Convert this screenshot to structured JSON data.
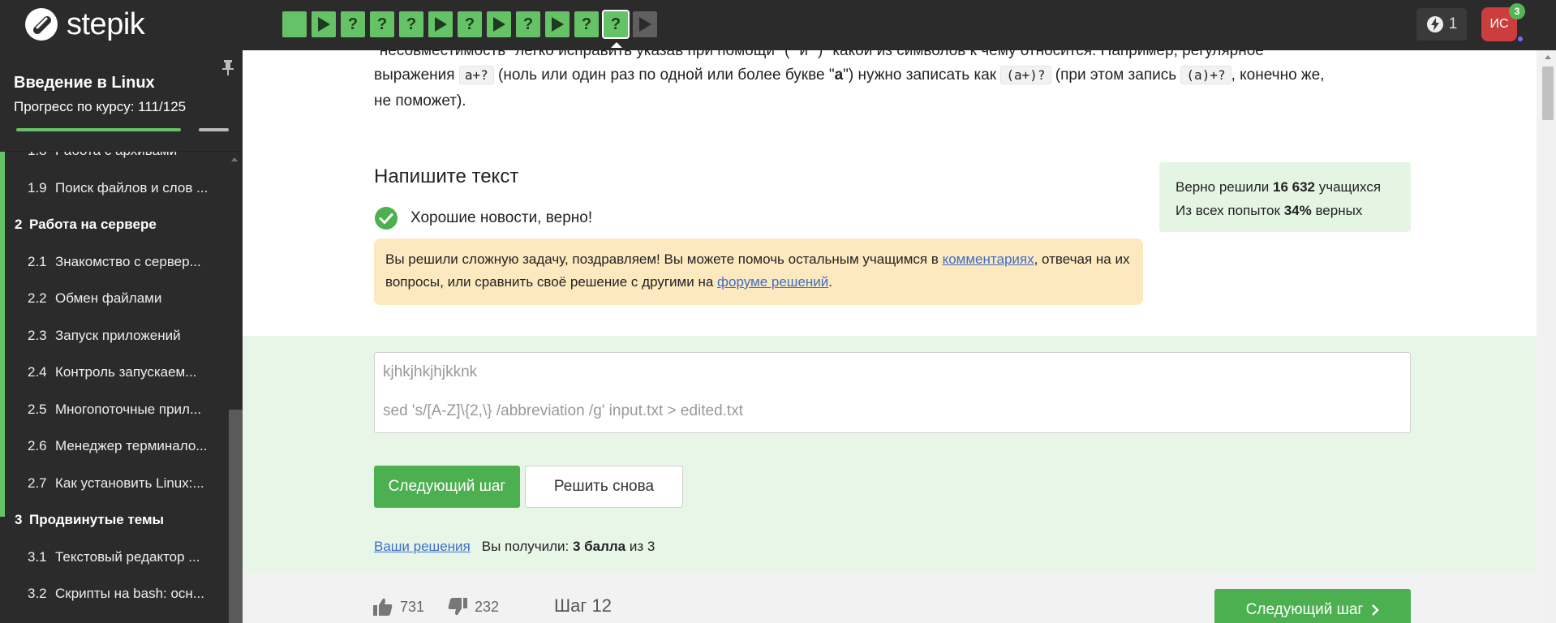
{
  "header": {
    "logo_text": "stepik",
    "steps": [
      {
        "kind": "blank",
        "color": "green"
      },
      {
        "kind": "video",
        "color": "green"
      },
      {
        "kind": "question",
        "color": "green"
      },
      {
        "kind": "question",
        "color": "green"
      },
      {
        "kind": "question",
        "color": "green"
      },
      {
        "kind": "video",
        "color": "green"
      },
      {
        "kind": "question",
        "color": "green"
      },
      {
        "kind": "video",
        "color": "green"
      },
      {
        "kind": "question",
        "color": "green"
      },
      {
        "kind": "video",
        "color": "green"
      },
      {
        "kind": "question",
        "color": "green"
      },
      {
        "kind": "question",
        "color": "green",
        "current": true
      },
      {
        "kind": "video",
        "color": "grey"
      }
    ],
    "energy_count": "1",
    "avatar_initials": "ИС",
    "notification_count": "3"
  },
  "sidebar": {
    "course_title": "Введение в Linux",
    "progress_label": "Прогресс по курсу:  111/125",
    "progress_value": 0.888,
    "items": [
      {
        "type": "item",
        "num": "1.8",
        "label": "Работа с архивами",
        "partial": true
      },
      {
        "type": "item",
        "num": "1.9",
        "label": "Поиск файлов и слов ..."
      },
      {
        "type": "section",
        "num": "2",
        "label": "Работа на сервере"
      },
      {
        "type": "item",
        "num": "2.1",
        "label": "Знакомство с сервер..."
      },
      {
        "type": "item",
        "num": "2.2",
        "label": "Обмен файлами"
      },
      {
        "type": "item",
        "num": "2.3",
        "label": "Запуск приложений"
      },
      {
        "type": "item",
        "num": "2.4",
        "label": "Контроль запускаем..."
      },
      {
        "type": "item",
        "num": "2.5",
        "label": "Многопоточные прил..."
      },
      {
        "type": "item",
        "num": "2.6",
        "label": "Менеджер терминало..."
      },
      {
        "type": "item",
        "num": "2.7",
        "label": "Как установить Linux:..."
      },
      {
        "type": "section",
        "num": "3",
        "label": "Продвинутые темы"
      },
      {
        "type": "item",
        "num": "3.1",
        "label": "Текстовый редактор ..."
      },
      {
        "type": "item",
        "num": "3.2",
        "label": "Скрипты на bash: осн..."
      }
    ]
  },
  "lesson": {
    "para_top": "\"несовместимость\" легко исправить указав при помощи \"(\" и \")\" какой из символов к чему относится. Например, регулярное",
    "para_l2_a": "выражения ",
    "code_1": "a+?",
    "para_l2_b": " (ноль или один раз по одной или более букве \"",
    "para_l2_bold": "a",
    "para_l2_c": "\") нужно записать как ",
    "code_2": "(a+)?",
    "para_l2_d": " (при этом запись ",
    "code_3": "(a)+?",
    "para_l2_e": ", конечно же,",
    "para_l3": "не поможет).",
    "section_title": "Напишите текст",
    "correct_text": "Хорошие новости, верно!",
    "congrats_a": "Вы решили сложную задачу, поздравляем! Вы можете помочь остальным учащимся в ",
    "congrats_link1": "комментариях",
    "congrats_b": ", отвечая на их вопросы, или сравнить своё решение с другими на ",
    "congrats_link2": "форуме решений",
    "congrats_c": ".",
    "stats_l1_a": "Верно решили ",
    "stats_l1_bold": "16 632",
    "stats_l1_b": " учащихся",
    "stats_l2_a": "Из всех попыток ",
    "stats_l2_bold": "34%",
    "stats_l2_b": " верных",
    "answer_line1": "kjhkjhkjhjkknk",
    "answer_line2": "sed 's/[A-Z]\\{2,\\} /abbreviation /g' input.txt > edited.txt",
    "btn_next": "Следующий шаг",
    "btn_retry": "Решить снова",
    "your_solutions": "Ваши решения",
    "result_prefix": "Вы получили: ",
    "result_score": "3 балла",
    "result_suffix": " из 3"
  },
  "footer": {
    "likes": "731",
    "dislikes": "232",
    "step_label": "Шаг 12",
    "btn_next": "Следующий шаг"
  },
  "colors": {
    "accent_green": "#4caf50",
    "step_green": "#66c266",
    "link_blue": "#3e6ec7",
    "congrats_bg": "#fde9c0",
    "stats_bg": "#e4f5e4"
  }
}
